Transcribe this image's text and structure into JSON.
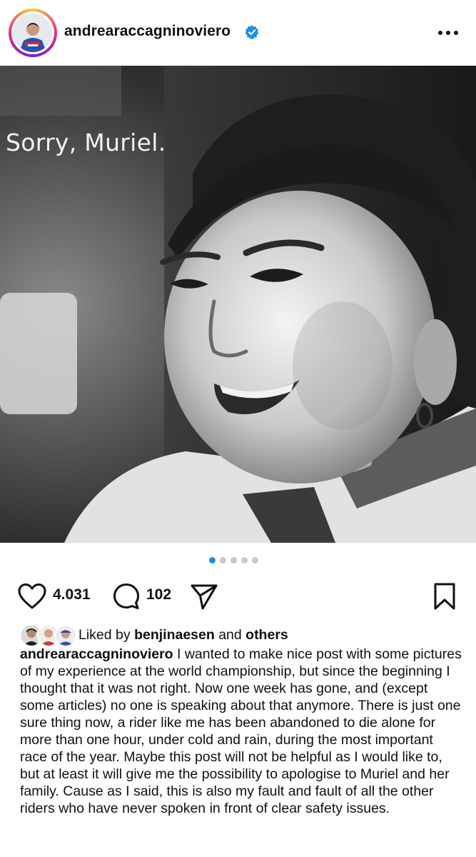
{
  "header": {
    "username": "andrearaccagninoviero",
    "verified_icon": "verified-badge-icon",
    "more_icon": "more-options-icon"
  },
  "photo": {
    "overlay_text": "Sorry, Muriel."
  },
  "carousel": {
    "total": 5,
    "active_index": 0
  },
  "actions": {
    "likes": "4.031",
    "comments": "102",
    "like_icon": "heart-icon",
    "comment_icon": "comment-icon",
    "share_icon": "share-icon",
    "save_icon": "bookmark-icon"
  },
  "liked_by": {
    "prefix": "Liked by ",
    "user": "benjinaesen",
    "middle": " and ",
    "suffix": "others"
  },
  "caption": {
    "username": "andrearaccagninoviero",
    "text": "I wanted to make nice post with some pictures of my experience at the world championship, but since the beginning I thought that it was not right. Now one week has gone, and (except some articles) no one is speaking about that anymore. There is just one sure thing now, a rider like me has been abandoned to die alone for more than one hour, under cold and rain, during the most important race of the year. Maybe this post will not be helpful as I would like to, but at least it will give me the possibility to apologise to Muriel and her family. Cause as I said, this is also my fault and fault of all the other riders who have never spoken in front of clear safety issues."
  },
  "colors": {
    "accent": "#1e90e6",
    "text": "#111111",
    "dot_inactive": "#c9c9c9"
  }
}
